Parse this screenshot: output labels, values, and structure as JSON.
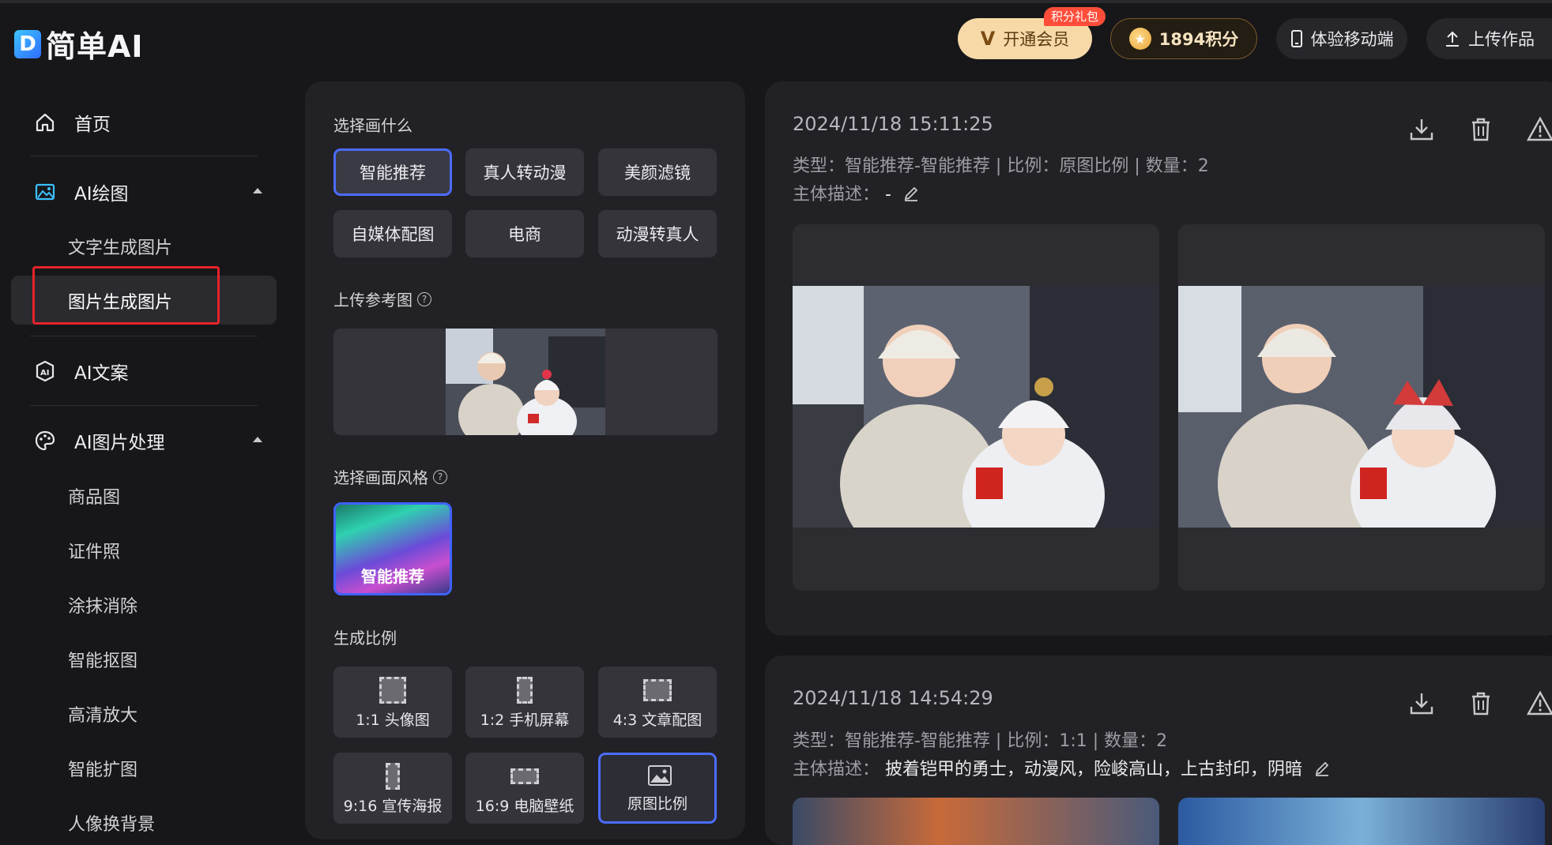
{
  "header": {
    "logo_mark": "D",
    "logo_text": "简单AI",
    "vip_label": "开通会员",
    "vip_badge": "积分礼包",
    "points_label": "1894积分",
    "mobile_label": "体验移动端",
    "upload_label": "上传作品"
  },
  "sidebar": {
    "home": "首页",
    "ai_drawing": "AI绘图",
    "text_to_image": "文字生成图片",
    "image_to_image": "图片生成图片",
    "ai_copy": "AI文案",
    "ai_image_processing": "AI图片处理",
    "sub_items": [
      "商品图",
      "证件照",
      "涂抹消除",
      "智能抠图",
      "高清放大",
      "智能扩图",
      "人像换背景"
    ]
  },
  "panel": {
    "choose_label": "选择画什么",
    "chips": [
      "智能推荐",
      "真人转动漫",
      "美颜滤镜",
      "自媒体配图",
      "电商",
      "动漫转真人"
    ],
    "upload_ref_label": "上传参考图",
    "style_label": "选择画面风格",
    "style_card": "智能推荐",
    "ratio_label": "生成比例",
    "ratios": [
      "1:1 头像图",
      "1:2 手机屏幕",
      "4:3 文章配图",
      "9:16 宣传海报",
      "16:9 电脑壁纸",
      "原图比例"
    ]
  },
  "results": [
    {
      "timestamp": "2024/11/18 15:11:25",
      "meta": "类型：智能推荐-智能推荐 | 比例：原图比例 | 数量：2",
      "desc_label": "主体描述：",
      "desc_value": "-"
    },
    {
      "timestamp": "2024/11/18 14:54:29",
      "meta": "类型：智能推荐-智能推荐 | 比例：1:1 | 数量：2",
      "desc_label": "主体描述：",
      "desc_value": "披着铠甲的勇士，动漫风，险峻高山，上古封印，阴暗"
    }
  ],
  "icons": {
    "home": "home-icon",
    "drawing": "image-icon",
    "copy": "ai-text-icon",
    "processing": "palette-icon",
    "download": "download-icon",
    "delete": "trash-icon",
    "report": "warning-icon",
    "edit": "pencil-icon",
    "help": "question-icon"
  },
  "colors": {
    "accent": "#4b6cff",
    "highlight_box": "#e8232a",
    "vip_bg": "#f7d9a8",
    "badge": "#ff4d3a"
  }
}
